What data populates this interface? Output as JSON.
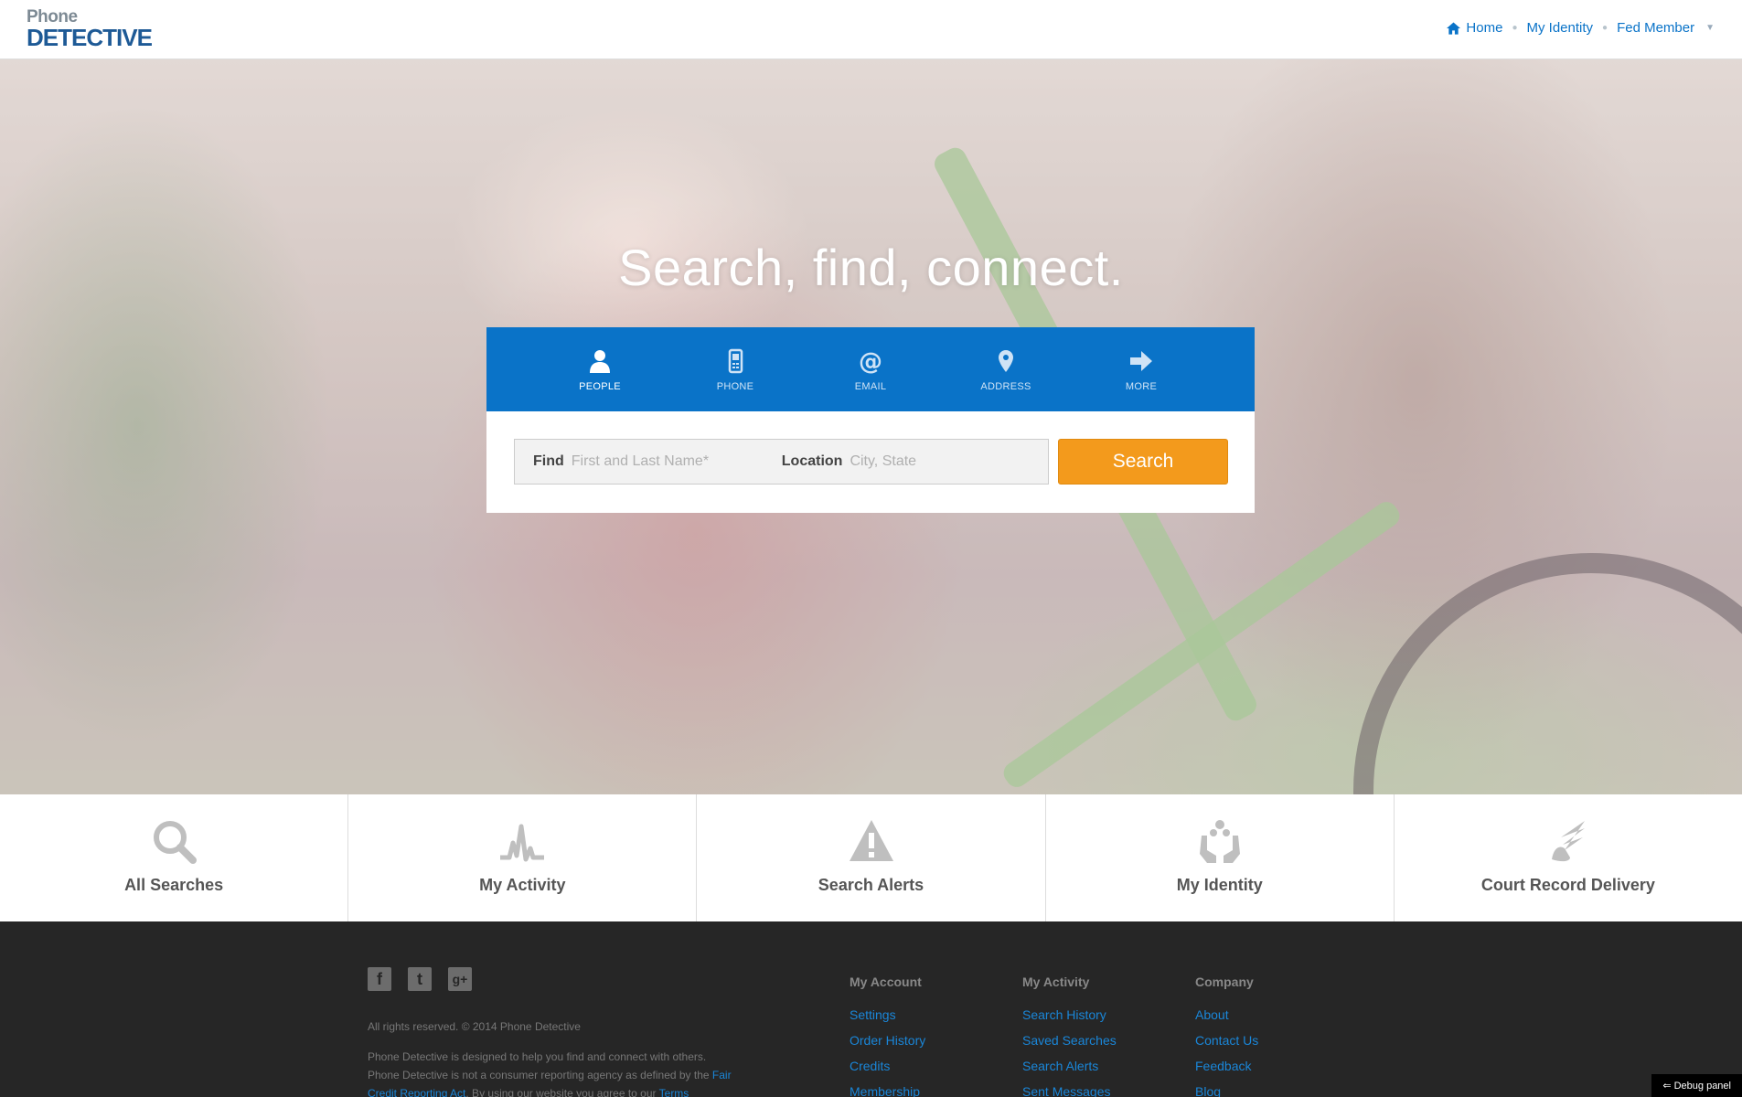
{
  "header": {
    "logo_top": "Phone",
    "logo_bottom": "DETECTIVE",
    "nav": {
      "home": "Home",
      "identity": "My Identity",
      "member": "Fed Member"
    }
  },
  "hero": {
    "headline": "Search, find, connect."
  },
  "search": {
    "tabs": [
      {
        "label": "PEOPLE",
        "icon": "person-icon"
      },
      {
        "label": "PHONE",
        "icon": "phone-icon"
      },
      {
        "label": "EMAIL",
        "icon": "at-sign-icon"
      },
      {
        "label": "ADDRESS",
        "icon": "map-pin-icon"
      },
      {
        "label": "MORE",
        "icon": "arrow-right-icon"
      }
    ],
    "find_label": "Find",
    "find_placeholder": "First and Last Name*",
    "location_label": "Location",
    "location_placeholder": "City, State",
    "button": "Search"
  },
  "tiles": [
    {
      "label": "All Searches",
      "icon": "magnifier-icon"
    },
    {
      "label": "My Activity",
      "icon": "activity-graph-icon"
    },
    {
      "label": "Search Alerts",
      "icon": "warning-triangle-icon"
    },
    {
      "label": "My Identity",
      "icon": "hands-identity-icon"
    },
    {
      "label": "Court Record Delivery",
      "icon": "winged-foot-icon"
    }
  ],
  "footer": {
    "social": {
      "facebook": "f",
      "twitter": "t",
      "google": "g+"
    },
    "copyright": "All rights reserved. © 2014 Phone Detective",
    "disclaimer_1": "Phone Detective is designed to help you find and connect with others. Phone Detective is not a consumer reporting agency as defined by the",
    "disclaimer_link": "Fair Credit Reporting Act",
    "disclaimer_2": ". By using our website you agree to our",
    "disclaimer_terms": "Terms",
    "columns": [
      {
        "title": "My Account",
        "links": [
          "Settings",
          "Order History",
          "Credits",
          "Membership"
        ]
      },
      {
        "title": "My Activity",
        "links": [
          "Search History",
          "Saved Searches",
          "Search Alerts",
          "Sent Messages"
        ]
      },
      {
        "title": "Company",
        "links": [
          "About",
          "Contact Us",
          "Feedback",
          "Blog"
        ]
      }
    ]
  },
  "debug": "⇐ Debug panel",
  "colors": {
    "brand_blue": "#0a73c8",
    "search_orange": "#f39a1c",
    "footer_bg": "#262626"
  }
}
